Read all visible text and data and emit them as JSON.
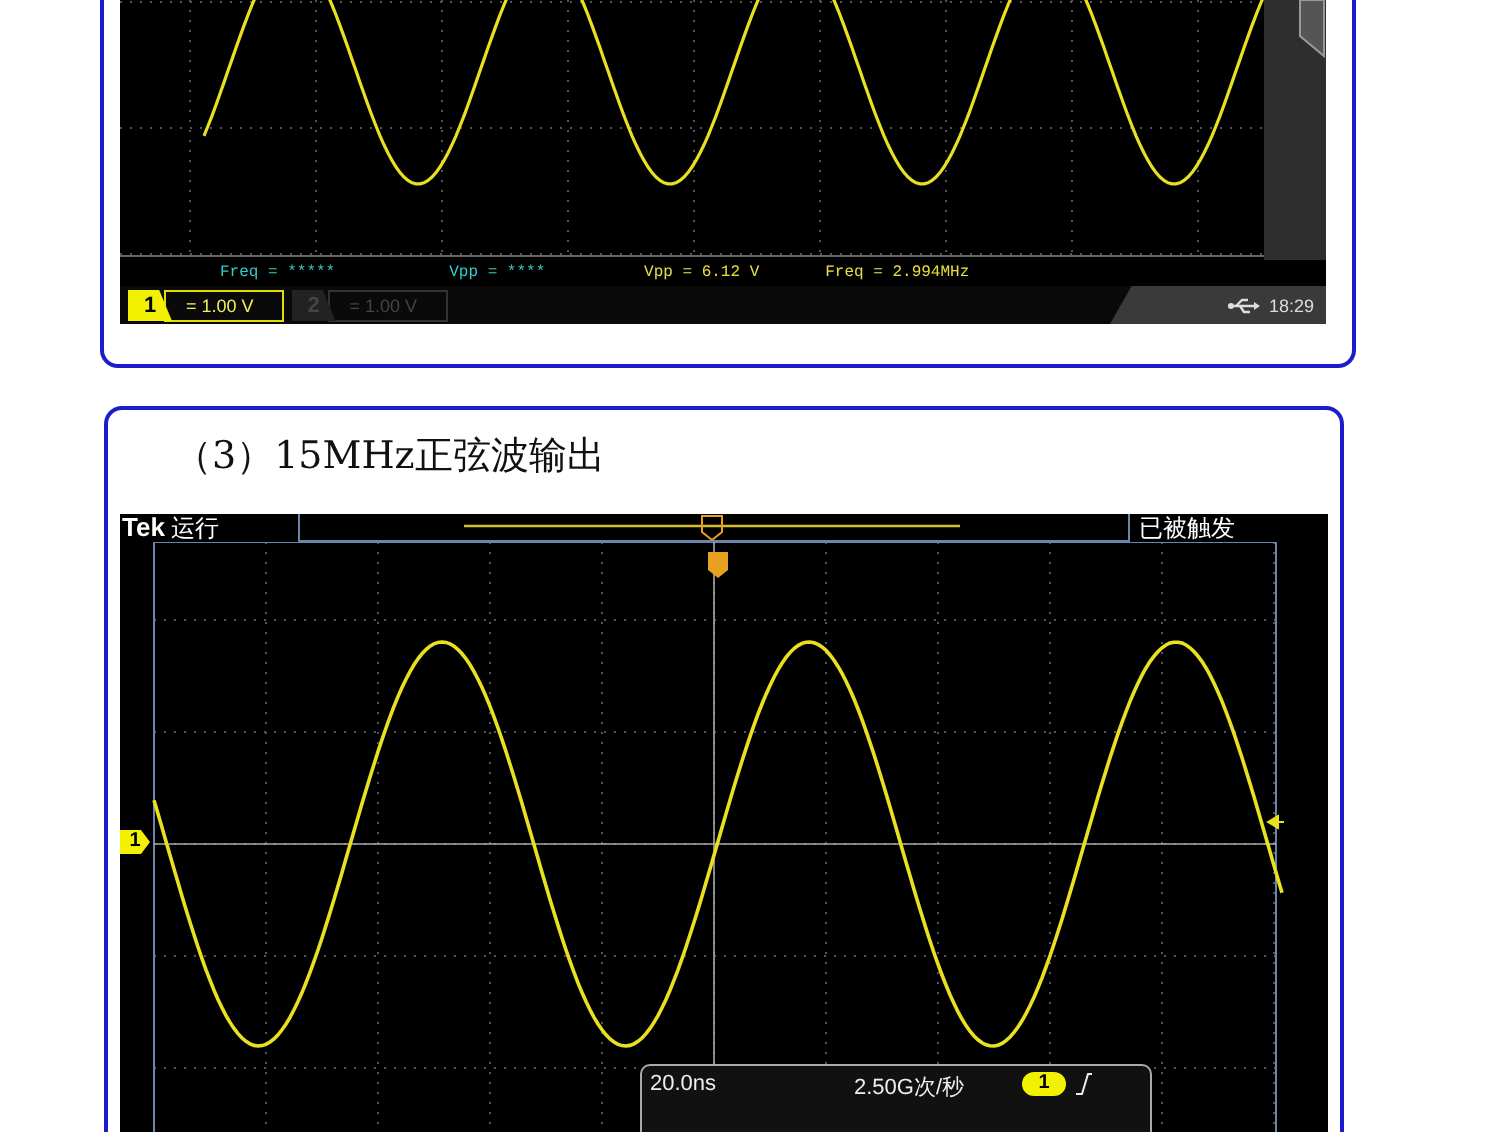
{
  "upper_scope": {
    "measurements": [
      {
        "text": "Freq = *****",
        "color": "#33cccc"
      },
      {
        "text": "Vpp = ****",
        "color": "#33cccc"
      },
      {
        "text": "Vpp = 6.12 V",
        "color": "#e8e040"
      },
      {
        "text": "Freq = 2.994MHz",
        "color": "#e8e040"
      }
    ],
    "channels": [
      {
        "label": "1",
        "scale": "= 1.00 V",
        "selected": true
      },
      {
        "label": "2",
        "scale": "= 1.00 V",
        "selected": false
      }
    ],
    "clock": "18:29"
  },
  "section": {
    "title": "（3）15MHz正弦波输出",
    "scope": {
      "brand": "Tek",
      "run_state": "运行",
      "trigger_status": "已被触发",
      "channel_marker": "1",
      "timebase": "20.0ns",
      "sample_rate": "2.50G次/秒",
      "trigger_channel": "1"
    }
  }
}
